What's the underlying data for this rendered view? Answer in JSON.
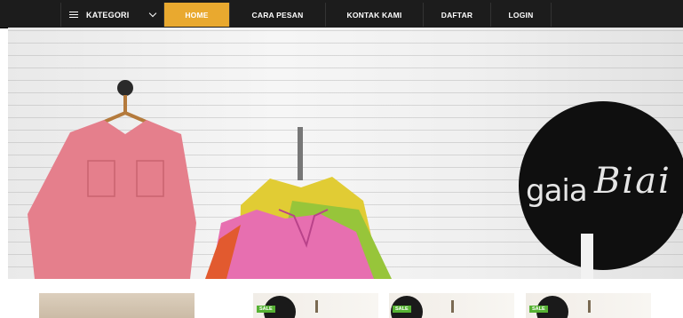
{
  "nav": {
    "category_label": "KATEGORI",
    "items": [
      {
        "label": "HOME",
        "active": true
      },
      {
        "label": "CARA PESAN",
        "active": false
      },
      {
        "label": "KONTAK KAMI",
        "active": false
      },
      {
        "label": "DAFTAR",
        "active": false
      },
      {
        "label": "LOGIN",
        "active": false
      }
    ],
    "accent_color": "#e9a92f",
    "icons": {
      "menu": "hamburger-icon",
      "dropdown": "chevron-down-icon"
    }
  },
  "hero": {
    "logo_word": "gaia",
    "logo_script": "Biai"
  },
  "products": [
    {
      "badge": ""
    },
    {
      "badge": "SALE"
    },
    {
      "badge": "SALE"
    },
    {
      "badge": "SALE"
    }
  ]
}
